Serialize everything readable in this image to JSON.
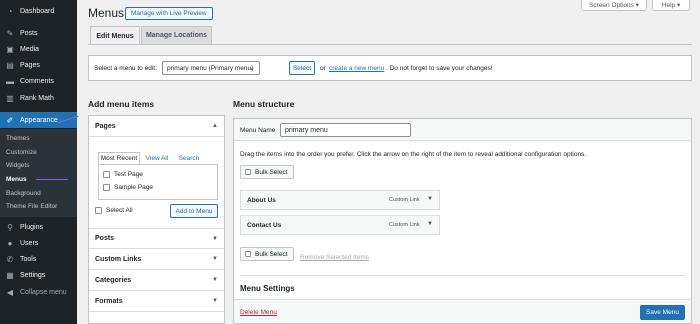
{
  "sidebar": {
    "items": [
      {
        "label": "Dashboard",
        "icon": "dashboard-icon",
        "glyph": "◔"
      },
      {
        "label": "Posts",
        "icon": "pin-icon",
        "glyph": "✎"
      },
      {
        "label": "Media",
        "icon": "media-icon",
        "glyph": "▣"
      },
      {
        "label": "Pages",
        "icon": "page-icon",
        "glyph": "▤"
      },
      {
        "label": "Comments",
        "icon": "comment-icon",
        "glyph": "▬"
      },
      {
        "label": "Rank Math",
        "icon": "chart-icon",
        "glyph": "▥"
      },
      {
        "label": "Appearance",
        "icon": "brush-icon",
        "glyph": "✐"
      }
    ],
    "submenu": [
      "Themes",
      "Customize",
      "Widgets",
      "Menus",
      "Background",
      "Theme File Editor"
    ],
    "lower": [
      {
        "label": "Plugins",
        "icon": "plugin-icon",
        "glyph": "⚲"
      },
      {
        "label": "Users",
        "icon": "users-icon",
        "glyph": "●"
      },
      {
        "label": "Tools",
        "icon": "wrench-icon",
        "glyph": "✆"
      },
      {
        "label": "Settings",
        "icon": "settings-icon",
        "glyph": "▦"
      },
      {
        "label": "Collapse menu",
        "icon": "collapse-icon",
        "glyph": "◀"
      }
    ]
  },
  "screen_options": "Screen Options ▾",
  "help": "Help ▾",
  "title": "Menus",
  "live_preview": "Manage with Live Preview",
  "tabs": [
    "Edit Menus",
    "Manage Locations"
  ],
  "select_bar": {
    "label": "Select a menu to edit:",
    "selected": "primary menu (Primary menu)",
    "button": "Select",
    "or": "or",
    "create_link": "create a new menu",
    "hint": ". Do not forget to save your changes!"
  },
  "add_items": {
    "heading": "Add menu items",
    "pages": "Pages",
    "page_tabs": [
      "Most Recent",
      "View All",
      "Search"
    ],
    "pages_list": [
      "Test Page",
      "Sample Page"
    ],
    "select_all": "Select All",
    "add_button": "Add to Menu",
    "sections": [
      "Posts",
      "Custom Links",
      "Categories",
      "Formats"
    ]
  },
  "structure": {
    "heading": "Menu structure",
    "menu_name_label": "Menu Name",
    "menu_name_value": "primary menu",
    "drag_hint": "Drag the items into the order you prefer. Click the arrow on the right of the item to reveal additional configuration options.",
    "bulk_select": "Bulk Select",
    "items": [
      {
        "title": "About Us",
        "type": "Custom Link"
      },
      {
        "title": "Contact Us",
        "type": "Custom Link"
      }
    ],
    "remove_selected": "Remove Selected Items",
    "settings_title": "Menu Settings",
    "delete_menu": "Delete Menu",
    "save_menu": "Save Menu"
  },
  "colors": {
    "sidebar": "#1d2327",
    "accent": "#2271b1",
    "annotation_arrow": "#8a5cf5"
  }
}
